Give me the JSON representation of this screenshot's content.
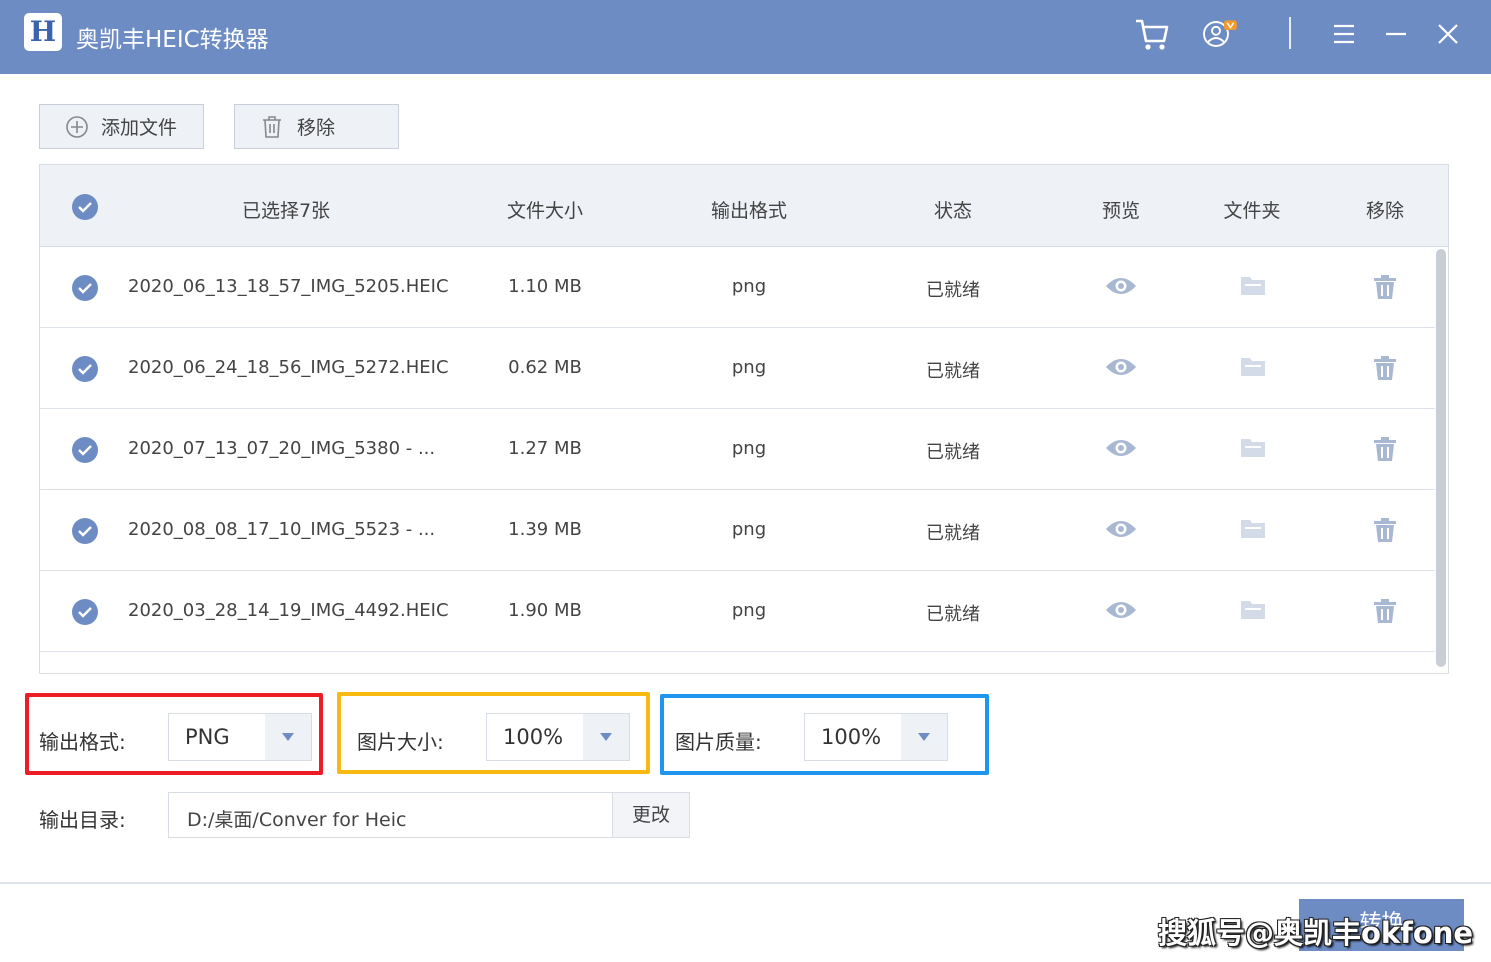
{
  "app": {
    "logo_letter": "H",
    "title": "奥凯丰HEIC转换器"
  },
  "toolbar": {
    "add_label": "添加文件",
    "remove_label": "移除"
  },
  "table": {
    "headers": {
      "name": "已选择7张",
      "size": "文件大小",
      "format": "输出格式",
      "status": "状态",
      "preview": "预览",
      "folder": "文件夹",
      "remove": "移除"
    },
    "rows": [
      {
        "name": "2020_06_13_18_57_IMG_5205.HEIC",
        "size": "1.10 MB",
        "format": "png",
        "status": "已就绪"
      },
      {
        "name": "2020_06_24_18_56_IMG_5272.HEIC",
        "size": "0.62 MB",
        "format": "png",
        "status": "已就绪"
      },
      {
        "name": "2020_07_13_07_20_IMG_5380 - ...",
        "size": "1.27 MB",
        "format": "png",
        "status": "已就绪"
      },
      {
        "name": "2020_08_08_17_10_IMG_5523 - ...",
        "size": "1.39 MB",
        "format": "png",
        "status": "已就绪"
      },
      {
        "name": "2020_03_28_14_19_IMG_4492.HEIC",
        "size": "1.90 MB",
        "format": "png",
        "status": "已就绪"
      }
    ]
  },
  "options": {
    "format_label": "输出格式:",
    "format_value": "PNG",
    "size_label": "图片大小:",
    "size_value": "100%",
    "quality_label": "图片质量:",
    "quality_value": "100%"
  },
  "output": {
    "label": "输出目录:",
    "path": "D:/桌面/Conver for Heic",
    "change_label": "更改"
  },
  "footer": {
    "convert_label": "转换",
    "watermark": "搜狐号@奥凯丰okfone"
  },
  "colors": {
    "accent": "#6e8cc4",
    "highlight_red": "#ee1c25",
    "highlight_yellow": "#f8b912",
    "highlight_blue": "#1e96f0"
  }
}
